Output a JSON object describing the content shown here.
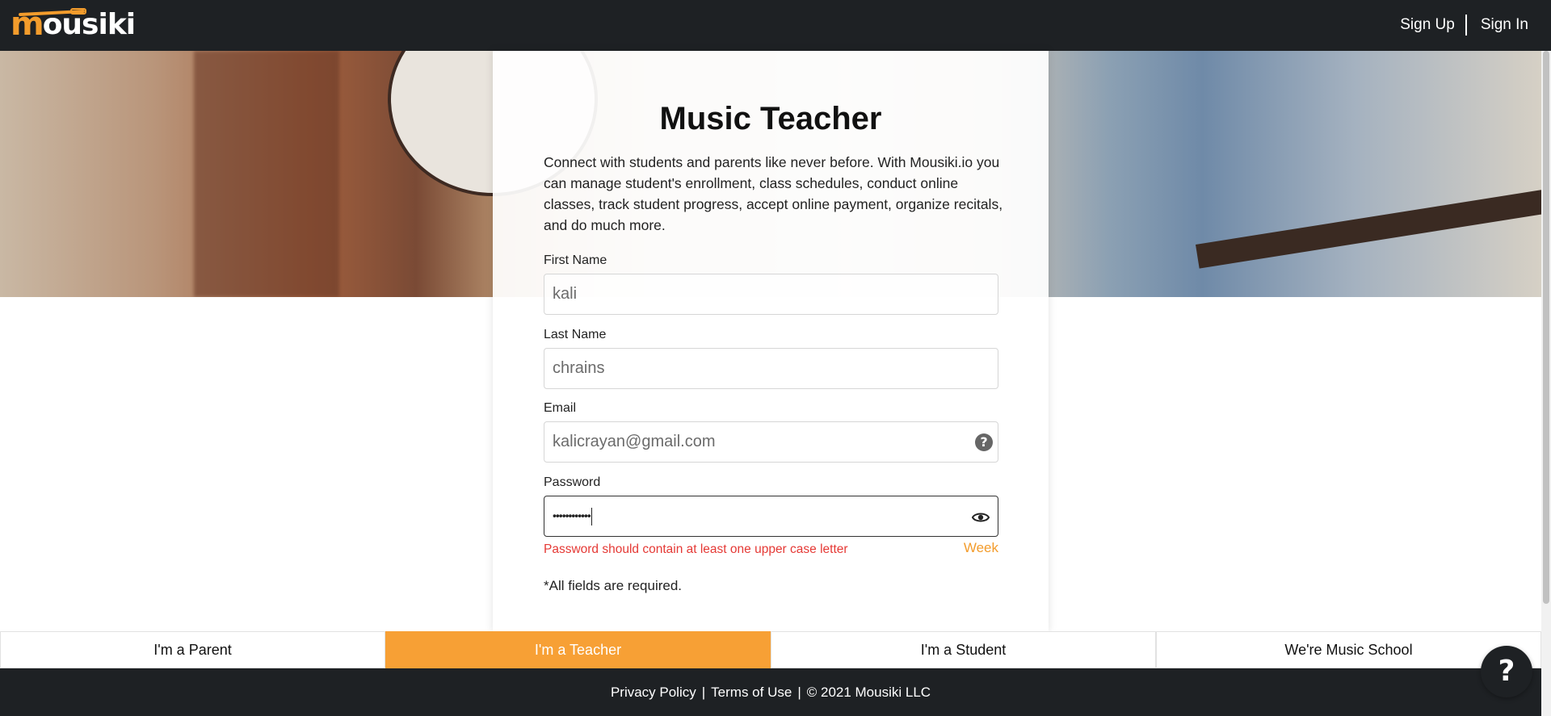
{
  "header": {
    "logo_text_m": "m",
    "logo_text_rest": "ousiki",
    "signup_label": "Sign Up",
    "signin_label": "Sign In"
  },
  "card": {
    "title": "Music Teacher",
    "description": "Connect with students and parents like never before. With Mousiki.io you can manage student's enrollment, class schedules, conduct online classes, track student progress, accept online payment, organize recitals, and do much more.",
    "fields": {
      "first_name": {
        "label": "First Name",
        "value": "kali"
      },
      "last_name": {
        "label": "Last Name",
        "value": "chrains"
      },
      "email": {
        "label": "Email",
        "value": "kalicrayan@gmail.com",
        "help_icon": "question-circle-icon"
      },
      "password": {
        "label": "Password",
        "value": "••••••••••••",
        "toggle_icon": "eye-icon"
      }
    },
    "password_error": "Password should contain at least one upper case letter",
    "password_strength": "Week",
    "required_note": "*All fields are required."
  },
  "roles": [
    {
      "label": "I'm a Parent",
      "active": false
    },
    {
      "label": "I'm a Teacher",
      "active": true
    },
    {
      "label": "I'm a Student",
      "active": false
    },
    {
      "label": "We're Music School",
      "active": false
    }
  ],
  "footer": {
    "privacy": "Privacy Policy",
    "sep1": "|",
    "terms": "Terms of Use",
    "sep2": "|",
    "copyright": "© 2021 Mousiki LLC"
  },
  "help_button": "?",
  "colors": {
    "accent": "#f7a035",
    "dark": "#1e2124",
    "error": "#e53935"
  }
}
